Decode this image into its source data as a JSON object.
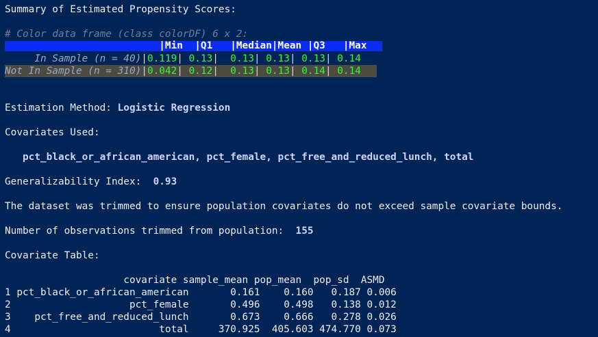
{
  "summary_title": "Summary of Estimated Propensity Scores:",
  "colordf_comment": "# Color data frame (class colorDF) 6 x 2:",
  "propensity_table": {
    "header_text": "                          |Min  |Q1   |Median|Mean |Q3   |Max  ",
    "rows": [
      {
        "label": "     In Sample (n = 40)",
        "cells": [
          "0.119",
          " 0.13",
          "  0.13",
          " 0.13",
          " 0.13",
          " 0.14"
        ]
      },
      {
        "label": "Not In Sample (n = 310)",
        "cells": [
          "0.042",
          " 0.12",
          "  0.13",
          " 0.13",
          " 0.14",
          " 0.14"
        ]
      }
    ]
  },
  "estimation_method_label": "Estimation Method: ",
  "estimation_method_value": "Logistic Regression",
  "covariates_used_label": "Covariates Used:",
  "covariates_list": "   pct_black_or_african_american, pct_female, pct_free_and_reduced_lunch, total",
  "gen_index_label": "Generalizability Index:  ",
  "gen_index_value": "0.93",
  "trim_note": "The dataset was trimmed to ensure population covariates do not exceed sample covariate bounds.",
  "trimmed_label": "Number of observations trimmed from population:  ",
  "trimmed_value": "155",
  "covariate_table_label": "Covariate Table:",
  "covariate_table": {
    "header": "                    covariate sample_mean pop_mean  pop_sd  ASMD",
    "rows": [
      "1 pct_black_or_african_american       0.161    0.160   0.187 0.006",
      "2                    pct_female       0.496    0.498   0.138 0.012",
      "3    pct_free_and_reduced_lunch       0.673    0.666   0.278 0.026",
      "4                         total     370.925  405.603 474.770 0.073"
    ]
  },
  "colors": {
    "background": "#012456",
    "text": "#eeedf0",
    "emphasis": "#cdd2ff",
    "header_band": "#0b2cf4",
    "value_green": "#3df33d",
    "alt_row_band": "#4b4b41"
  }
}
